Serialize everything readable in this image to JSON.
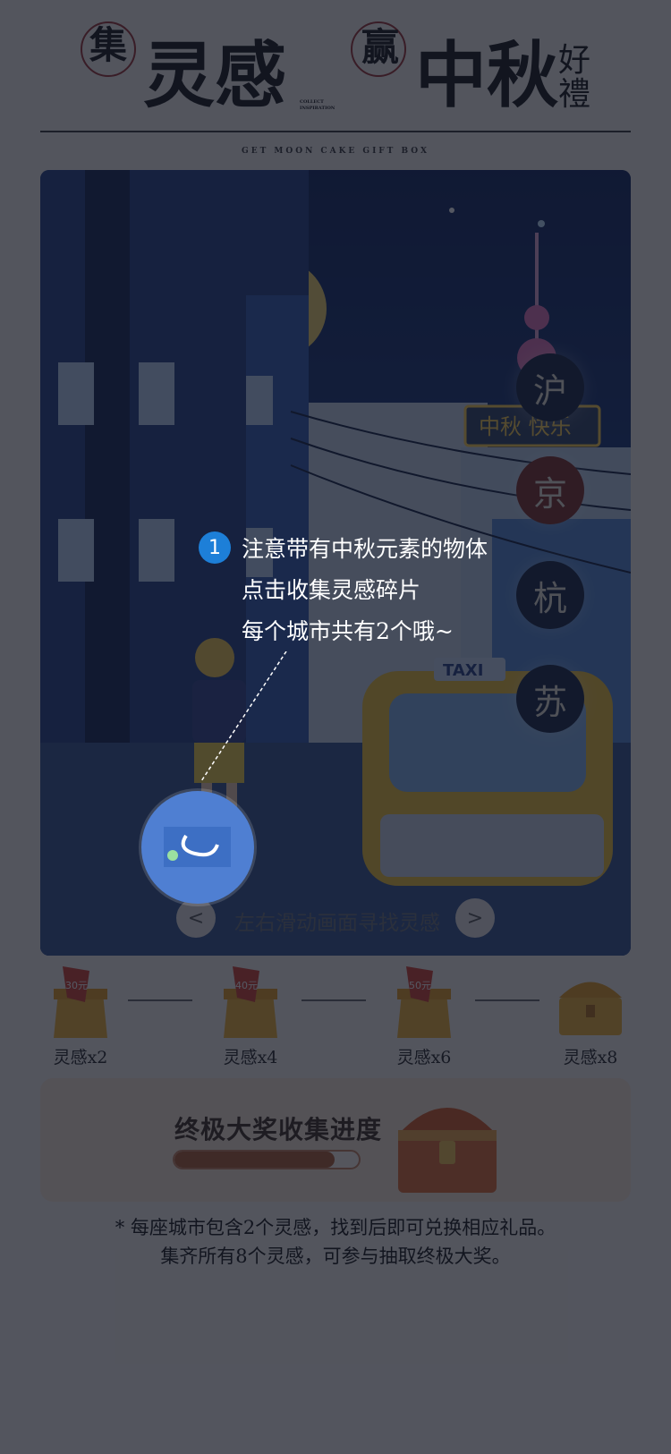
{
  "header": {
    "badge1": "集",
    "title1": "灵感",
    "tiny1": "COLLECT",
    "tiny2": "INSPIRATION",
    "badge2": "赢",
    "title2": "中秋",
    "title3a": "好",
    "title3b": "禮",
    "subtitle": "GET MOON CAKE GIFT BOX"
  },
  "scene": {
    "sign_text": "中秋 快乐",
    "taxi_text": "TAXI",
    "cities": [
      {
        "label": "沪",
        "active": false
      },
      {
        "label": "京",
        "active": true
      },
      {
        "label": "杭",
        "active": false
      },
      {
        "label": "苏",
        "active": false
      }
    ],
    "prev": "<",
    "next": ">",
    "swipe_hint": "左右滑动画面寻找灵感"
  },
  "tip": {
    "number": "1",
    "lines": [
      "注意带有中秋元素的物体",
      "点击收集灵感碎片",
      "每个城市共有2个哦~"
    ]
  },
  "rewards": [
    {
      "label": "灵感x2",
      "value": "30元"
    },
    {
      "label": "灵感x4",
      "value": "40元"
    },
    {
      "label": "灵感x6",
      "value": "50元"
    },
    {
      "label": "灵感x8",
      "value": ""
    }
  ],
  "grand": {
    "title": "终极大奖收集进度",
    "progress": 0.87
  },
  "note": {
    "line1": "* 每座城市包含2个灵感，找到后即可兑换相应礼品。",
    "line2": "集齐所有8个灵感，可参与抽取终极大奖。"
  },
  "colors": {
    "overlay": "#141826",
    "tip_badge": "#1d7fd8",
    "progress": "#b05a2e",
    "panel": "#fbe9d4"
  }
}
